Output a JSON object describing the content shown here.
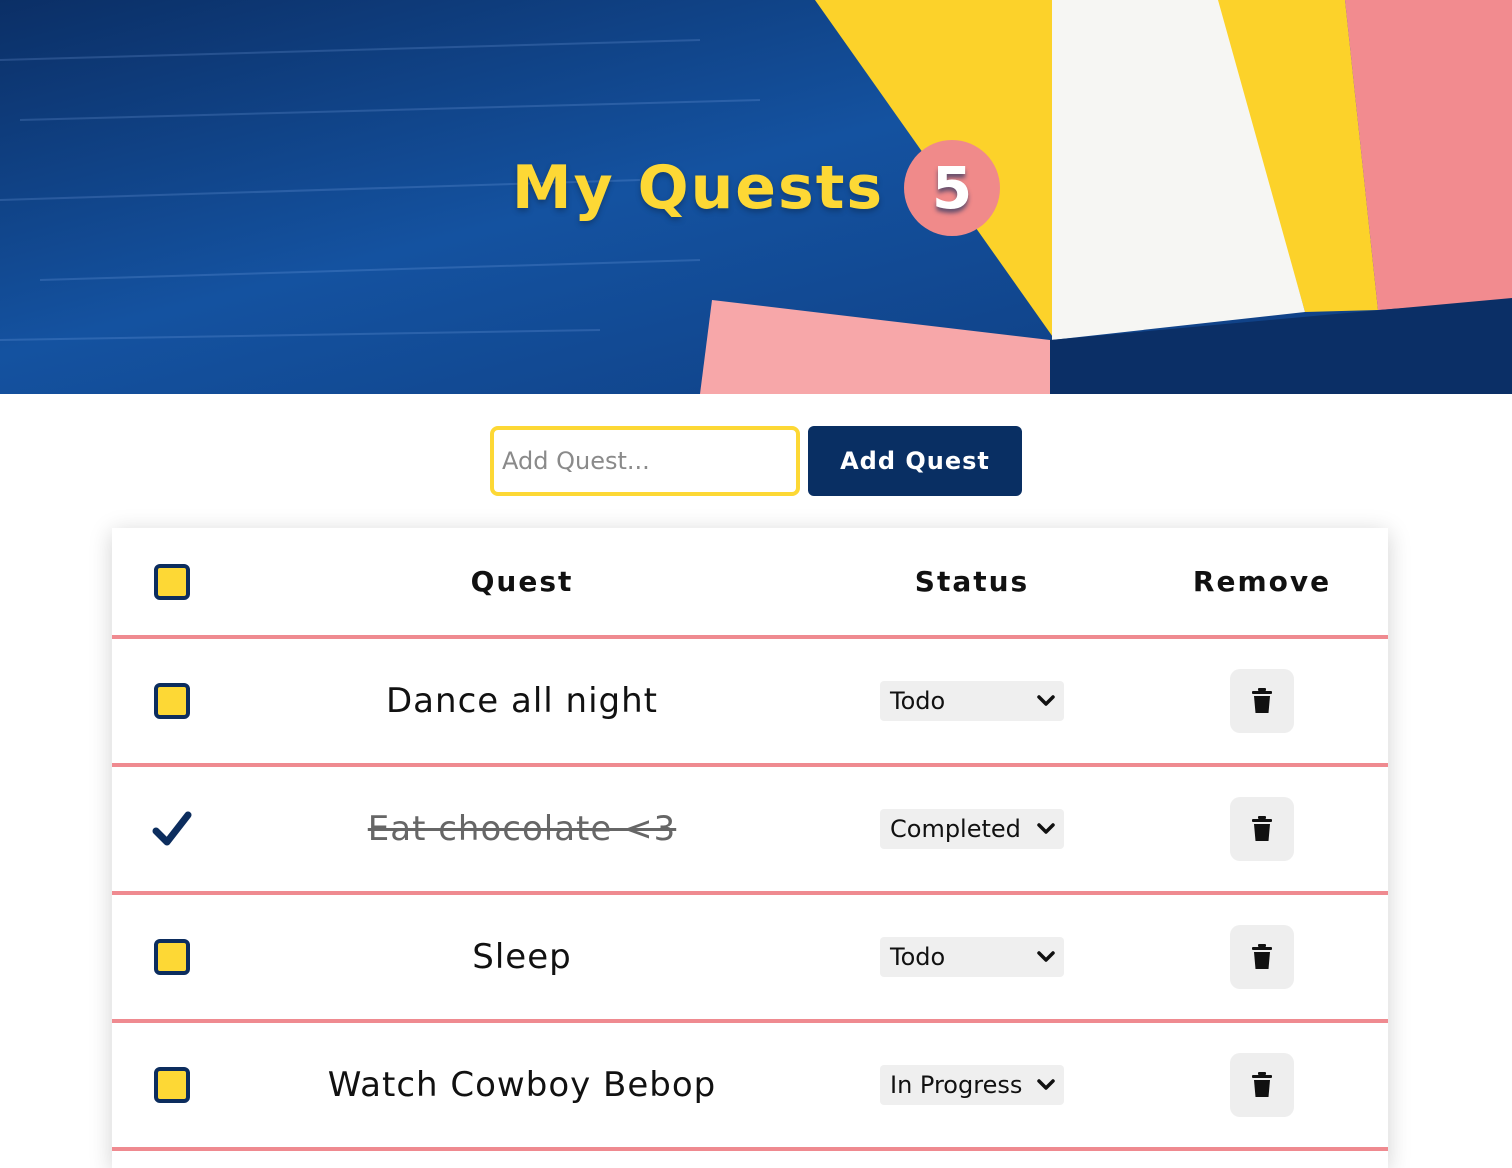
{
  "header": {
    "title": "My Quests",
    "count": "5"
  },
  "add_form": {
    "placeholder": "Add Quest...",
    "button_label": "Add Quest"
  },
  "table": {
    "columns": [
      "Quest",
      "Status",
      "Remove"
    ],
    "rows": [
      {
        "quest": "Dance all night",
        "status": "Todo",
        "completed": false
      },
      {
        "quest": "Eat chocolate <3",
        "status": "Completed",
        "completed": true
      },
      {
        "quest": "Sleep",
        "status": "Todo",
        "completed": false
      },
      {
        "quest": "Watch Cowboy Bebop",
        "status": "In Progress",
        "completed": false
      }
    ]
  },
  "colors": {
    "navy": "#092f63",
    "yellow": "#fdd835",
    "pink": "#f08a8a",
    "divider": "#ef8a90"
  },
  "icons": {
    "check": "checkmark-icon",
    "remove": "trash-icon",
    "dropdown": "chevron-down-icon"
  }
}
